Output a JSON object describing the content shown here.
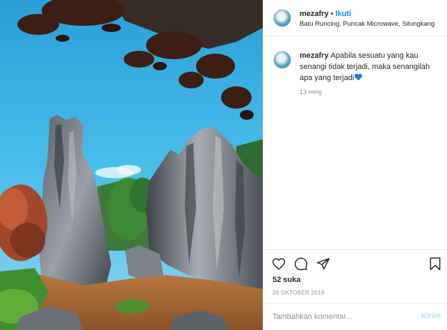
{
  "post": {
    "username": "mezafry",
    "separator": "•",
    "follow_label": "Ikuti",
    "location": "Batu Runcing, Puncak Microwave, Silungkang"
  },
  "caption": {
    "username": "mezafry",
    "text": "Apabila sesuatu yang kau senangi tidak terjadi, maka senangilah apa yang terjadi",
    "emoji": "blue-heart-icon",
    "time": "13 ming"
  },
  "actions": {
    "likes": "52 suka",
    "date": "26 OKTOBER 2019"
  },
  "add_comment": {
    "placeholder": "Tambahkan komentar...",
    "post_label": "Kirim"
  },
  "colors": {
    "link": "#0095f6",
    "heart_emoji": "#1d7fe3",
    "post_disabled": "#b2dffc"
  }
}
